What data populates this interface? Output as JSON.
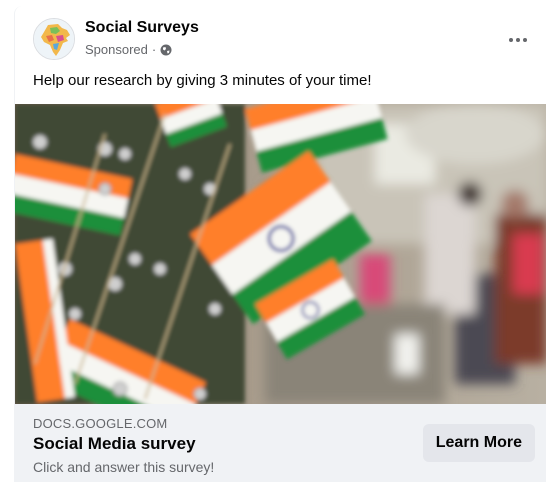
{
  "post": {
    "page_name": "Social Surveys",
    "sponsored_label": "Sponsored",
    "separator": "·",
    "privacy_icon": "globe-icon",
    "more_icon": "more-options-icon",
    "caption": "Help our research by giving 3 minutes of your time!"
  },
  "link_preview": {
    "domain": "DOCS.GOOGLE.COM",
    "title": "Social Media survey",
    "description": "Click and answer this survey!",
    "cta_label": "Learn More"
  },
  "colors": {
    "saffron": "#ff7f2a",
    "green": "#1f8f3a",
    "secondary_text": "#65676b",
    "link_area_bg": "#f0f2f5",
    "button_bg": "#e4e6eb"
  }
}
